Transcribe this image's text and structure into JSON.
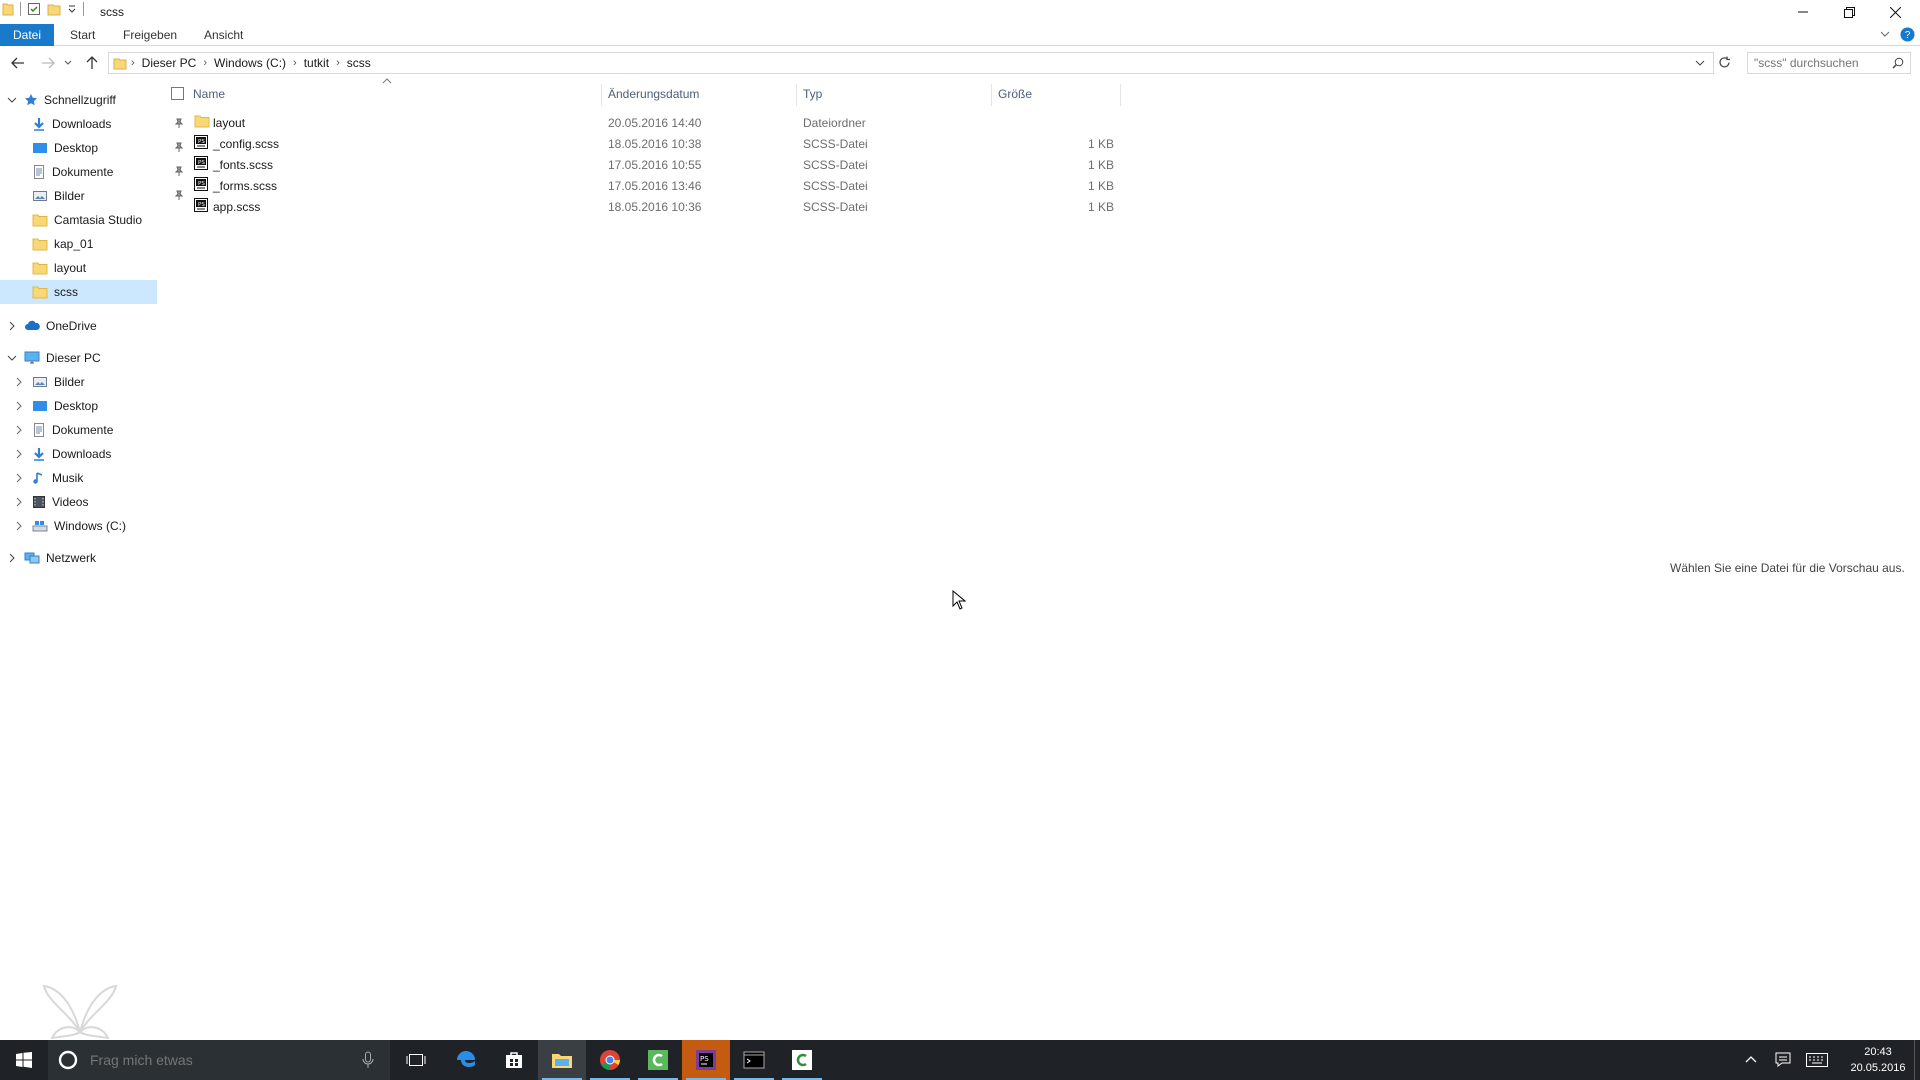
{
  "window": {
    "title": "scss"
  },
  "ribbon": {
    "tabs": [
      "Datei",
      "Start",
      "Freigeben",
      "Ansicht"
    ]
  },
  "address": {
    "breadcrumbs": [
      "Dieser PC",
      "Windows (C:)",
      "tutkit",
      "scss"
    ]
  },
  "search": {
    "placeholder": "\"scss\" durchsuchen"
  },
  "nav": {
    "quick_access": {
      "label": "Schnellzugriff",
      "items": [
        {
          "label": "Downloads",
          "icon": "download-icon",
          "pinned": true
        },
        {
          "label": "Desktop",
          "icon": "desktop-icon",
          "pinned": true
        },
        {
          "label": "Dokumente",
          "icon": "documents-icon",
          "pinned": true
        },
        {
          "label": "Bilder",
          "icon": "pictures-icon",
          "pinned": true
        },
        {
          "label": "Camtasia Studio",
          "icon": "folder-icon",
          "pinned": false
        },
        {
          "label": "kap_01",
          "icon": "folder-icon",
          "pinned": false
        },
        {
          "label": "layout",
          "icon": "folder-icon",
          "pinned": false
        },
        {
          "label": "scss",
          "icon": "folder-icon",
          "pinned": false,
          "selected": true
        }
      ]
    },
    "onedrive": {
      "label": "OneDrive"
    },
    "this_pc": {
      "label": "Dieser PC",
      "items": [
        {
          "label": "Bilder",
          "icon": "pictures-icon"
        },
        {
          "label": "Desktop",
          "icon": "desktop-icon"
        },
        {
          "label": "Dokumente",
          "icon": "documents-icon"
        },
        {
          "label": "Downloads",
          "icon": "download-icon"
        },
        {
          "label": "Musik",
          "icon": "music-icon"
        },
        {
          "label": "Videos",
          "icon": "videos-icon"
        },
        {
          "label": "Windows (C:)",
          "icon": "drive-icon"
        }
      ]
    },
    "network": {
      "label": "Netzwerk"
    }
  },
  "filelist": {
    "columns": [
      "Name",
      "Änderungsdatum",
      "Typ",
      "Größe"
    ],
    "rows": [
      {
        "name": "layout",
        "date": "20.05.2016 14:40",
        "type": "Dateiordner",
        "size": "",
        "icon": "folder-icon"
      },
      {
        "name": "_config.scss",
        "date": "18.05.2016 10:38",
        "type": "SCSS-Datei",
        "size": "1 KB",
        "icon": "scss-file-icon"
      },
      {
        "name": "_fonts.scss",
        "date": "17.05.2016 10:55",
        "type": "SCSS-Datei",
        "size": "1 KB",
        "icon": "scss-file-icon"
      },
      {
        "name": "_forms.scss",
        "date": "17.05.2016 13:46",
        "type": "SCSS-Datei",
        "size": "1 KB",
        "icon": "scss-file-icon"
      },
      {
        "name": "app.scss",
        "date": "18.05.2016 10:36",
        "type": "SCSS-Datei",
        "size": "1 KB",
        "icon": "scss-file-icon"
      }
    ]
  },
  "preview": {
    "message": "Wählen Sie eine Datei für die Vorschau aus."
  },
  "taskbar": {
    "search_placeholder": "Frag mich etwas",
    "time": "20:43",
    "date": "20.05.2016"
  },
  "colors": {
    "accent": "#1979ca",
    "selection": "#cce8ff",
    "taskbar": "#1f2327"
  }
}
